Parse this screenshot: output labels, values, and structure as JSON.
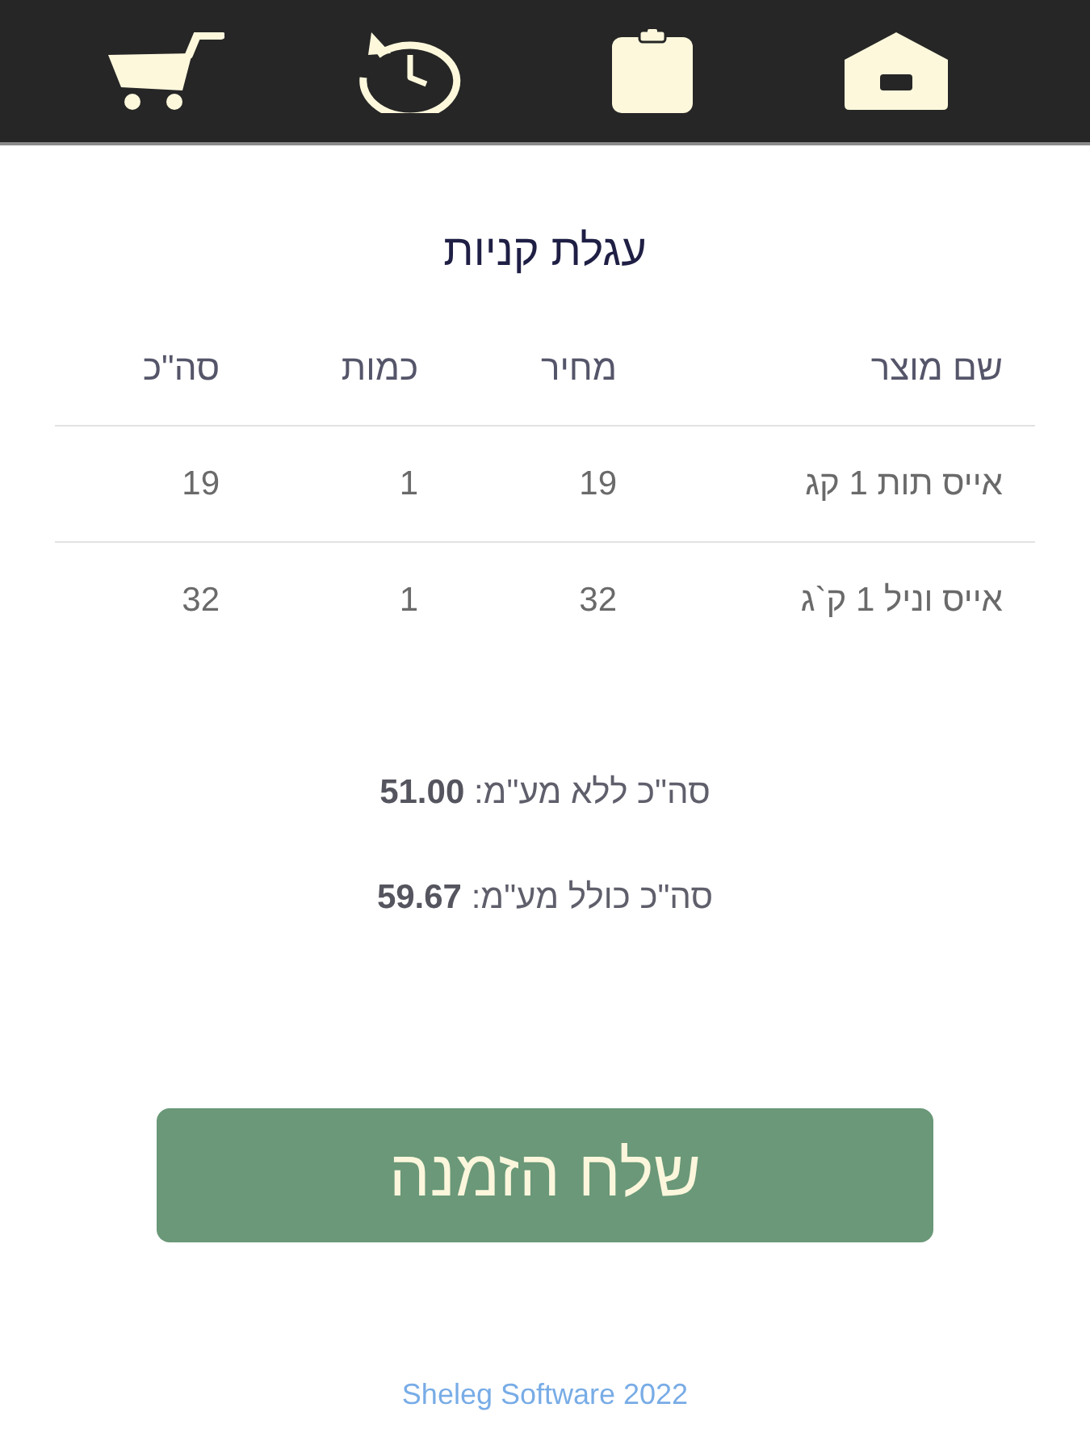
{
  "title": "עגלת קניות",
  "table": {
    "columns": [
      "שם מוצר",
      "מחיר",
      "כמות",
      "סה\"כ"
    ],
    "rows": [
      [
        "אייס תות 1 קג",
        "19",
        "1",
        "19"
      ],
      [
        "אייס וניל 1 ק`ג",
        "32",
        "1",
        "32"
      ]
    ]
  },
  "totals": [
    "סה\"כ ללא מע\"מ: **51.00**",
    "סה\"כ כולל מע\"מ: **59.67**"
  ],
  "send_button": {
    "label": "שלח הזמנה"
  },
  "footer": "Sheleg Software 2022"
}
